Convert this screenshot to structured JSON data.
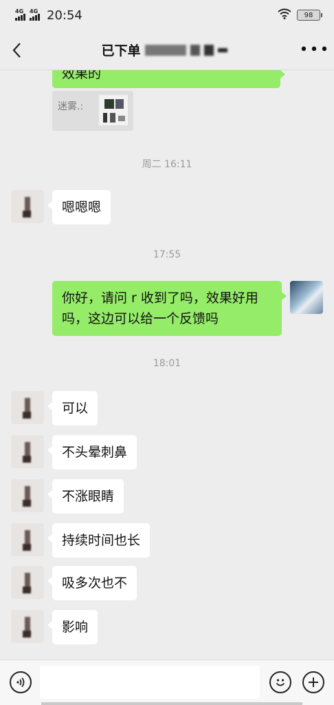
{
  "status_bar": {
    "signal1_label": "4G",
    "signal2_label": "4G",
    "time": "20:54",
    "battery": "98"
  },
  "nav": {
    "title": "已下单"
  },
  "messages": {
    "prev_out_text": "效果的",
    "quote_label": "迷雾.:",
    "ts1": "周二 16:11",
    "m1": "嗯嗯嗯",
    "ts2": "17:55",
    "m2_line1": "你好，请问 r 收到了吗，效果好用",
    "m2_line2": "吗，这边可以给一个反馈吗",
    "ts3": "18:01",
    "m3": "可以",
    "m4": "不头晕刺鼻",
    "m5": "不涨眼睛",
    "m6": "持续时间也长",
    "m7": "吸多次也不",
    "m8": "影响"
  },
  "input_bar": {
    "voice_icon": "voice-icon",
    "emoji_icon": "emoji-icon",
    "add_icon": "add-icon"
  }
}
